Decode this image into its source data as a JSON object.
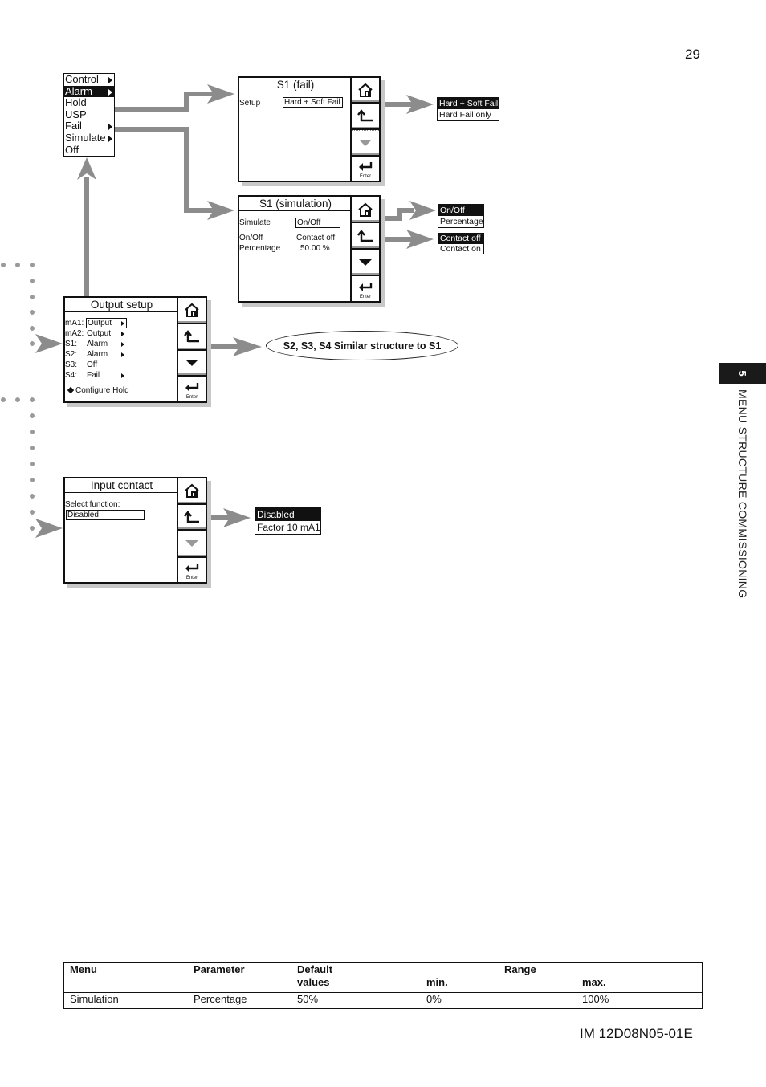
{
  "page": {
    "number": "29",
    "doc_id": "IM 12D08N05-01E",
    "chapter_number": "5",
    "chapter_title": "MENU STRUCTURE COMMISSIONING"
  },
  "colors": {
    "arrow": "#8c8c8c",
    "dot": "#9a9a9a",
    "selected_bg": "#111111",
    "shadow": "#c8c8c8"
  },
  "alarm_menu": {
    "items": [
      {
        "label": "Control",
        "has_submenu": true,
        "selected": false
      },
      {
        "label": "Alarm",
        "has_submenu": true,
        "selected": true
      },
      {
        "label": "Hold",
        "has_submenu": false,
        "selected": false
      },
      {
        "label": "USP",
        "has_submenu": false,
        "selected": false
      },
      {
        "label": "Fail",
        "has_submenu": true,
        "selected": false
      },
      {
        "label": "Simulate",
        "has_submenu": true,
        "selected": false
      },
      {
        "label": "Off",
        "has_submenu": false,
        "selected": false
      }
    ]
  },
  "screens": {
    "s1_fail": {
      "title": "S1 (fail)",
      "setup_label": "Setup",
      "setup_value": "Hard + Soft Fail",
      "buttons": {
        "home": "home-icon",
        "back": "back-icon",
        "down": "down-icon",
        "enter": "Enter"
      },
      "down_enabled": false
    },
    "s1_simulation": {
      "title": "S1 (simulation)",
      "simulate_label": "Simulate",
      "simulate_value": "On/Off",
      "onoff_label": "On/Off",
      "onoff_value": "Contact off",
      "percentage_label": "Percentage",
      "percentage_value": "50.00 %",
      "buttons": {
        "enter": "Enter"
      },
      "down_enabled": true
    },
    "output_setup": {
      "title": "Output setup",
      "rows": [
        {
          "label": "mA1:",
          "value": "Output",
          "has_submenu": true,
          "boxed": true
        },
        {
          "label": "mA2:",
          "value": "Output",
          "has_submenu": true,
          "boxed": false
        },
        {
          "label": "S1:",
          "value": "Alarm",
          "has_submenu": true,
          "boxed": false
        },
        {
          "label": "S2:",
          "value": "Alarm",
          "has_submenu": true,
          "boxed": false
        },
        {
          "label": "S3:",
          "value": "Off",
          "has_submenu": false,
          "boxed": false
        },
        {
          "label": "S4:",
          "value": "Fail",
          "has_submenu": true,
          "boxed": false
        }
      ],
      "configure_hold": "Configure Hold",
      "buttons": {
        "enter": "Enter"
      },
      "down_enabled": true
    },
    "input_contact": {
      "title": "Input contact",
      "select_label": "Select function:",
      "select_value": "Disabled",
      "buttons": {
        "enter": "Enter"
      },
      "down_enabled": false
    }
  },
  "option_lists": {
    "fail_setup": [
      {
        "label": "Hard + Soft Fail",
        "selected": true
      },
      {
        "label": "Hard Fail only",
        "selected": false
      }
    ],
    "simulate": [
      {
        "label": "On/Off",
        "selected": true
      },
      {
        "label": "Percentage",
        "selected": false
      }
    ],
    "contact": [
      {
        "label": "Contact off",
        "selected": true
      },
      {
        "label": "Contact on",
        "selected": false
      }
    ],
    "input_function": [
      {
        "label": "Disabled",
        "selected": true
      },
      {
        "label": "Factor 10 mA1",
        "selected": false
      }
    ]
  },
  "note": "S2, S3, S4 Similar structure to S1",
  "table": {
    "headers": {
      "menu": "Menu",
      "parameter": "Parameter",
      "default_line1": "Default",
      "default_line2": "values",
      "range": "Range",
      "min": "min.",
      "max": "max."
    },
    "rows": [
      {
        "menu": "Simulation",
        "parameter": "Percentage",
        "default": "50%",
        "min": "0%",
        "max": "100%"
      }
    ]
  }
}
